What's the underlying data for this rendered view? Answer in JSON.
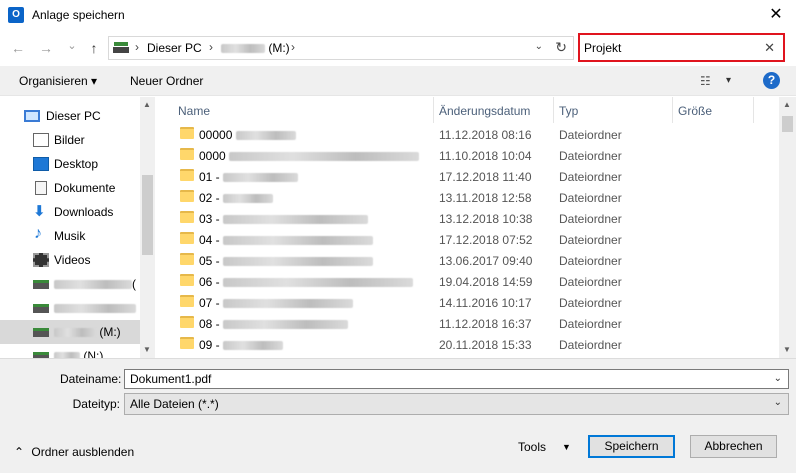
{
  "window": {
    "title": "Anlage speichern",
    "app_icon_letter": "O",
    "close_glyph": "✕"
  },
  "nav": {
    "back": "←",
    "forward": "→",
    "recent": "⌄",
    "up": "↑",
    "crumbs": [
      "Dieser PC",
      "(M:)"
    ],
    "sep": "›",
    "dropdown": "⌄",
    "refresh": "↻"
  },
  "search": {
    "value": "Projekt",
    "clear": "✕"
  },
  "toolbar": {
    "organize": "Organisieren ▾",
    "new_folder": "Neuer Ordner",
    "view_icon": "☷",
    "view_arrow": "▾",
    "help": "?"
  },
  "sidebar": {
    "items": [
      {
        "label": "Dieser PC",
        "icon": "monitor-icon"
      },
      {
        "label": "Bilder",
        "icon": "pictures-icon"
      },
      {
        "label": "Desktop",
        "icon": "desktop-icon"
      },
      {
        "label": "Dokumente",
        "icon": "documents-icon"
      },
      {
        "label": "Downloads",
        "icon": "downloads-icon"
      },
      {
        "label": "Musik",
        "icon": "music-icon"
      },
      {
        "label": "Videos",
        "icon": "videos-icon"
      },
      {
        "label": "(",
        "icon": "network-drive-icon"
      },
      {
        "label": "",
        "icon": "network-drive-icon"
      },
      {
        "label": "(M:)",
        "icon": "network-drive-icon"
      },
      {
        "label": "(N:)",
        "icon": "network-drive-icon"
      }
    ]
  },
  "columns": {
    "name": "Name",
    "date": "Änderungsdatum",
    "type": "Typ",
    "size": "Größe"
  },
  "files": [
    {
      "prefix": "00000",
      "date": "11.12.2018 08:16",
      "type": "Dateiordner"
    },
    {
      "prefix": "0000",
      "date": "11.10.2018 10:04",
      "type": "Dateiordner"
    },
    {
      "prefix": "01 -",
      "date": "17.12.2018 11:40",
      "type": "Dateiordner"
    },
    {
      "prefix": "02 -",
      "date": "13.11.2018 12:58",
      "type": "Dateiordner"
    },
    {
      "prefix": "03 -",
      "date": "13.12.2018 10:38",
      "type": "Dateiordner"
    },
    {
      "prefix": "04 -",
      "date": "17.12.2018 07:52",
      "type": "Dateiordner"
    },
    {
      "prefix": "05 -",
      "date": "13.06.2017 09:40",
      "type": "Dateiordner"
    },
    {
      "prefix": "06 -",
      "date": "19.04.2018 14:59",
      "type": "Dateiordner"
    },
    {
      "prefix": "07 -",
      "date": "14.11.2016 10:17",
      "type": "Dateiordner"
    },
    {
      "prefix": "08 -",
      "date": "11.12.2018 16:37",
      "type": "Dateiordner"
    },
    {
      "prefix": "09 -",
      "date": "20.11.2018 15:33",
      "type": "Dateiordner"
    }
  ],
  "form": {
    "filename_label": "Dateiname:",
    "filename_value": "Dokument1.pdf",
    "filetype_label": "Dateityp:",
    "filetype_value": "Alle Dateien (*.*)",
    "chevron": "⌄"
  },
  "footer": {
    "hide_folders": "Ordner ausblenden",
    "hide_arrow": "⌃",
    "tools": "Tools",
    "tools_arrow": "▼",
    "save": "Speichern",
    "cancel": "Abbrechen"
  },
  "colors": {
    "search_highlight": "#e0141e",
    "accent": "#0078d7",
    "folder": "#ffd76b"
  }
}
